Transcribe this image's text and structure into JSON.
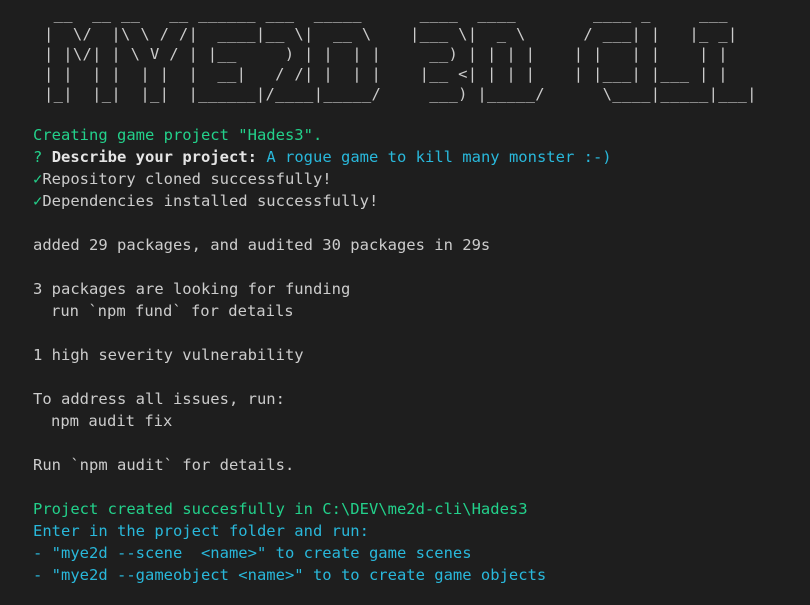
{
  "banner": {
    "art": " __  __ __   __ ______ ___  _____      ____  ____        ____ _     ___\n|  \\/  |\\ \\ / /|  ____|__ \\|  __ \\    |___ \\|  _ \\      / ___| |   |_ _|\n| |\\/| | \\ V / | |__     ) | |  | |     __) | | | |    | |   | |    | |\n| |  | |  | |  |  __|   / /| |  | |    |__ <| | | |    | |___| |___ | |\n|_|  |_|  |_|  |______|/____|_____/     ___) |_____/      \\____|_____|___|"
  },
  "lines": {
    "creating": "Creating game project \"Hades3\".",
    "prompt_mark": "?",
    "prompt_label": "Describe your project:",
    "prompt_answer": "A rogue game to kill many monster :-)",
    "check_mark": "✓",
    "cloned": "Repository cloned successfully!",
    "installed": "Dependencies installed successfully!",
    "added": "added 29 packages, and audited 30 packages in 29s",
    "funding": "3 packages are looking for funding",
    "fund_details": "run `npm fund` for details",
    "vuln": "1 high severity vulnerability",
    "address": "To address all issues, run:",
    "audit_fix": "npm audit fix",
    "run_audit": "Run `npm audit` for details.",
    "created": "Project created succesfully in C:\\DEV\\me2d-cli\\Hades3",
    "enter": "Enter in the project folder and run:",
    "hint_scene": "- \"mye2d --scene  <name>\" to create game scenes",
    "hint_gameobject": "- \"mye2d --gameobject <name>\" to to create game objects"
  },
  "colors": {
    "background": "#1e1e1e",
    "text": "#cccccc",
    "green": "#23d18b",
    "cyan": "#29b8db"
  }
}
